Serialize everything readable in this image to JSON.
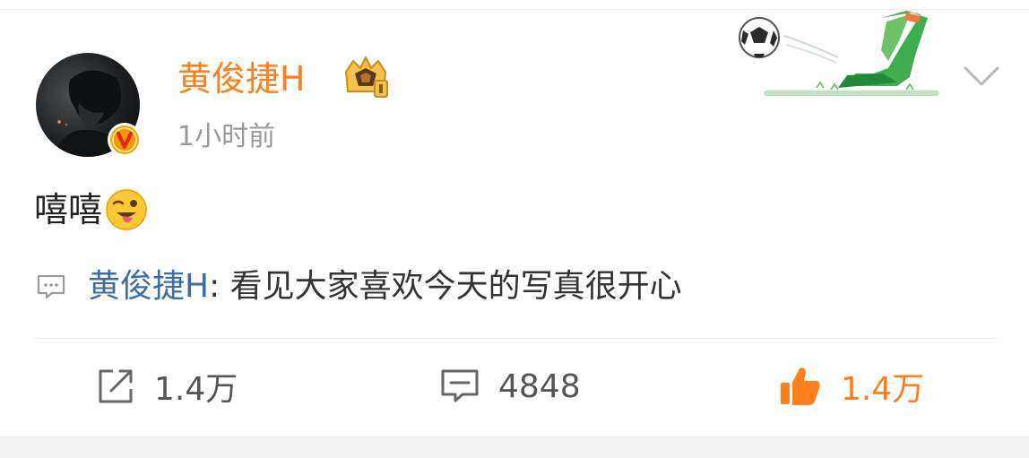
{
  "post": {
    "username": "黄俊捷H",
    "timestamp": "1小时前",
    "text": "嘻嘻",
    "emoji": "winking-tongue-emoji",
    "pinned_comment": {
      "author": "黄俊捷H",
      "separator": ":",
      "text": "看见大家喜欢今天的写真很开心"
    }
  },
  "actions": {
    "repost_count": "1.4万",
    "comment_count": "4848",
    "like_count": "1.4万"
  },
  "colors": {
    "username": "#ff7f1a",
    "comment_author": "#3a6ea5",
    "like_active": "#ff7f1a"
  }
}
